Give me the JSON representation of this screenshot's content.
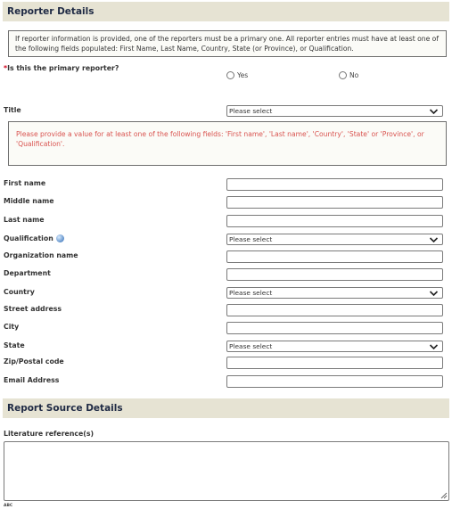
{
  "reporter_section": {
    "title": "Reporter Details"
  },
  "info_text": "If reporter information is provided, one of the reporters must be a primary one. All reporter entries must have at least one of the following fields populated:  First Name, Last Name, Country, State (or Province), or Qualification.",
  "primary": {
    "required_mark": "*",
    "question": "Is this the primary reporter?",
    "options": [
      "Yes",
      "No"
    ]
  },
  "title_field": {
    "label": "Title",
    "value": "Please select"
  },
  "error_text": "Please provide a value for at least one of the following fields: 'First name', 'Last name', 'Country', 'State' or 'Province', or 'Qualification'.",
  "fields": {
    "first_name": "First name",
    "middle_name": "Middle name",
    "last_name": "Last name",
    "qualification": "Qualification",
    "organization": "Organization name",
    "department": "Department",
    "country": "Country",
    "street": "Street address",
    "city": "City",
    "state": "State",
    "zip": "Zip/Postal code",
    "email": "Email Address"
  },
  "selects": {
    "qualification": "Please select",
    "country": "Please select",
    "state": "Please select"
  },
  "source_section": {
    "title": "Report Source Details"
  },
  "literature": {
    "label": "Literature reference(s)"
  },
  "spellcheck_label": "ABC"
}
